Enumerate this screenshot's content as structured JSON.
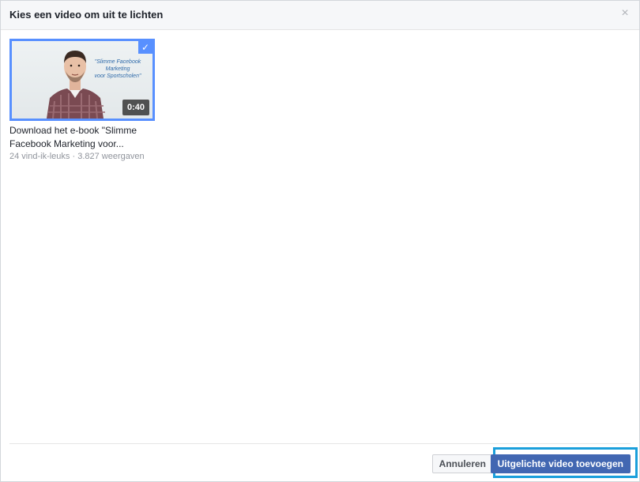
{
  "dialog": {
    "title": "Kies een video om uit te lichten",
    "close_icon": "×"
  },
  "videos": [
    {
      "title_line1": "Download het e-book \"Slimme",
      "title_line2": "Facebook Marketing voor...",
      "stats": "24 vind-ik-leuks · 3.827 weergaven",
      "duration": "0:40",
      "thumbnail_text_line1": "\"Slimme Facebook Marketing",
      "thumbnail_text_line2": "voor Sportscholen\"",
      "selected": true
    }
  ],
  "footer": {
    "cancel_label": "Annuleren",
    "add_label": "Uitgelichte video toevoegen"
  },
  "colors": {
    "accent": "#4267b2",
    "selection": "#5890ff",
    "highlight": "#1a9fdb"
  }
}
